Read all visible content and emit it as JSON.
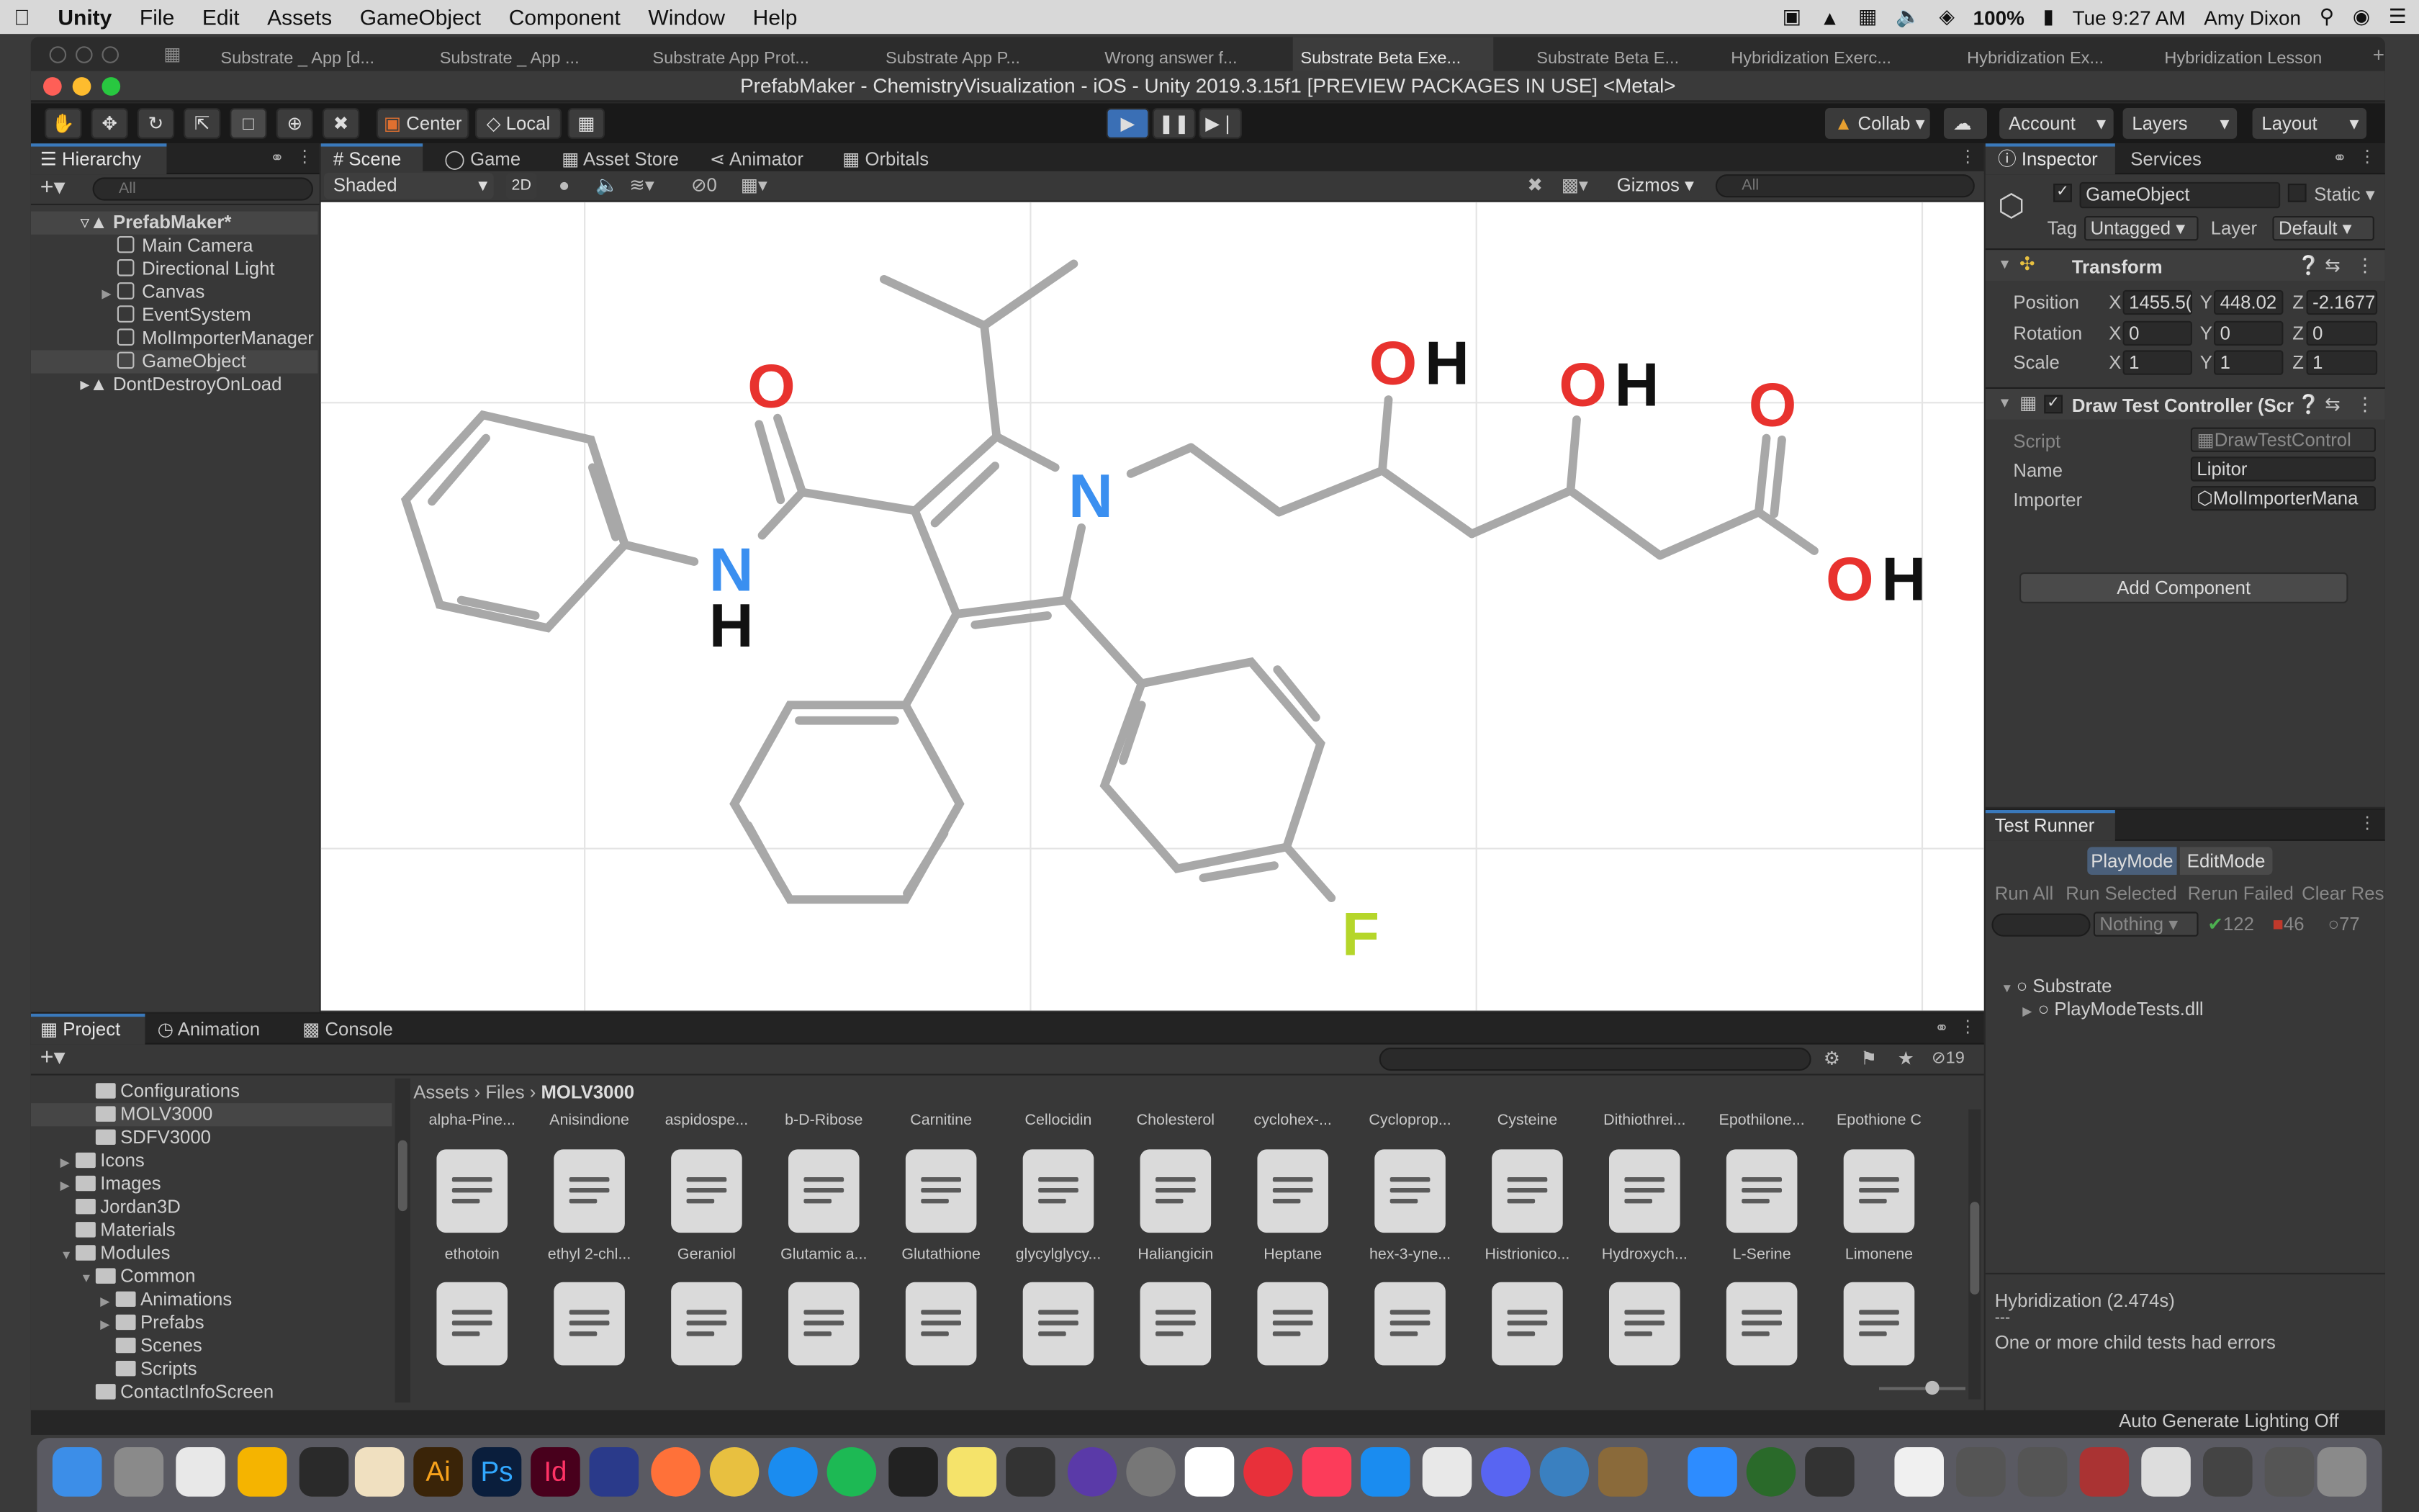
{
  "menubar": {
    "app_name": "Unity",
    "items": [
      "File",
      "Edit",
      "Assets",
      "GameObject",
      "Component",
      "Window",
      "Help"
    ],
    "battery": "100%",
    "clock": "Tue 9:27 AM",
    "user": "Amy Dixon"
  },
  "window_tabs": [
    "Substrate _ App [d...",
    "Substrate _ App ...",
    "Substrate App Prot...",
    "Substrate App P...",
    "Wrong answer f...",
    "Substrate Beta Exe...",
    "Substrate Beta E...",
    "Hybridization Exerc...",
    "Hybridization Ex...",
    "Hybridization Lesson"
  ],
  "window_title": "PrefabMaker - ChemistryVisualization - iOS - Unity 2019.3.15f1 [PREVIEW PACKAGES IN USE] <Metal>",
  "toolbar": {
    "pivot": "Center",
    "space": "Local",
    "collab": "Collab",
    "account": "Account",
    "layers": "Layers",
    "layout": "Layout"
  },
  "hierarchy": {
    "tab": "Hierarchy",
    "search_placeholder": "All",
    "scene": "PrefabMaker*",
    "items": [
      "Main Camera",
      "Directional Light",
      "Canvas",
      "EventSystem",
      "MolImporterManager",
      "GameObject"
    ],
    "dontdestroy": "DontDestroyOnLoad"
  },
  "scene_tabs": [
    "Scene",
    "Game",
    "Asset Store",
    "Animator",
    "Orbitals"
  ],
  "scene_bar": {
    "shading": "Shaded",
    "mode2d": "2D",
    "hidden_count": "0",
    "gizmos": "Gizmos",
    "search_placeholder": "All"
  },
  "molecule": {
    "atom_labels": {
      "o_amide": "O",
      "n_amide": "N",
      "h_amide": "H",
      "n_ring": "N",
      "oh1_o": "O",
      "oh1_h": "H",
      "oh2_o": "O",
      "oh2_h": "H",
      "o_acid": "O",
      "oh3_o": "O",
      "oh3_h": "H",
      "f": "F"
    },
    "colors": {
      "bond": "#a8a8a8",
      "oxygen": "#e8322e",
      "nitrogen": "#3a8ff0",
      "hydrogen": "#111111",
      "fluorine": "#b5d62a"
    }
  },
  "inspector": {
    "tabs": [
      "Inspector",
      "Services"
    ],
    "object_name": "GameObject",
    "static_label": "Static",
    "tag_label": "Tag",
    "tag_value": "Untagged",
    "layer_label": "Layer",
    "layer_value": "Default",
    "transform": {
      "title": "Transform",
      "rows": [
        {
          "label": "Position",
          "x": "1455.5(",
          "y": "448.02",
          "z": "-2.1677"
        },
        {
          "label": "Rotation",
          "x": "0",
          "y": "0",
          "z": "0"
        },
        {
          "label": "Scale",
          "x": "1",
          "y": "1",
          "z": "1"
        }
      ]
    },
    "component": {
      "title": "Draw Test Controller (Scr",
      "script_label": "Script",
      "script_value": "DrawTestControl",
      "name_label": "Name",
      "name_value": "Lipitor",
      "importer_label": "Importer",
      "importer_value": "MolImporterMana"
    },
    "add_component": "Add Component"
  },
  "test_runner": {
    "title": "Test Runner",
    "modes": [
      "PlayMode",
      "EditMode"
    ],
    "actions": [
      "Run All",
      "Run Selected",
      "Rerun Failed",
      "Clear Res"
    ],
    "filter": "Nothing",
    "passed": "122",
    "failed": "46",
    "skipped": "77",
    "tree": [
      "Substrate",
      "PlayModeTests.dll"
    ],
    "result_title": "Hybridization (2.474s)",
    "result_sep": "---",
    "result_message": "One or more child tests had errors"
  },
  "project": {
    "tabs": [
      "Project",
      "Animation",
      "Console"
    ],
    "hidden_count": "19",
    "tree": [
      {
        "label": "Configurations",
        "indent": 2
      },
      {
        "label": "MOLV3000",
        "indent": 2,
        "selected": true
      },
      {
        "label": "SDFV3000",
        "indent": 2
      },
      {
        "label": "Icons",
        "indent": 1,
        "arrow": true
      },
      {
        "label": "Images",
        "indent": 1,
        "arrow": true
      },
      {
        "label": "Jordan3D",
        "indent": 1
      },
      {
        "label": "Materials",
        "indent": 1
      },
      {
        "label": "Modules",
        "indent": 1,
        "arrow": true,
        "open": true
      },
      {
        "label": "Common",
        "indent": 2,
        "arrow": true,
        "open": true
      },
      {
        "label": "Animations",
        "indent": 3,
        "arrow": true
      },
      {
        "label": "Prefabs",
        "indent": 3,
        "arrow": true
      },
      {
        "label": "Scenes",
        "indent": 3
      },
      {
        "label": "Scripts",
        "indent": 3
      },
      {
        "label": "ContactInfoScreen",
        "indent": 2
      }
    ],
    "breadcrumb": [
      "Assets",
      "Files",
      "MOLV3000"
    ],
    "row_top_labels": [
      "alpha-Pine...",
      "Anisindione",
      "aspidospe...",
      "b-D-Ribose",
      "Carnitine",
      "Cellocidin",
      "Cholesterol",
      "cyclohex-...",
      "Cycloprop...",
      "Cysteine",
      "Dithiothrei...",
      "Epothilone...",
      "Epothione C"
    ],
    "row1_files": [
      "ethotoin",
      "ethyl 2-chl...",
      "Geraniol",
      "Glutamic a...",
      "Glutathione",
      "glycylglycy...",
      "Haliangicin",
      "Heptane",
      "hex-3-yne...",
      "Histrionico...",
      "Hydroxych...",
      "L-Serine",
      "Limonene"
    ],
    "row2_count": 13
  },
  "status_bar": "Auto Generate Lighting Off"
}
